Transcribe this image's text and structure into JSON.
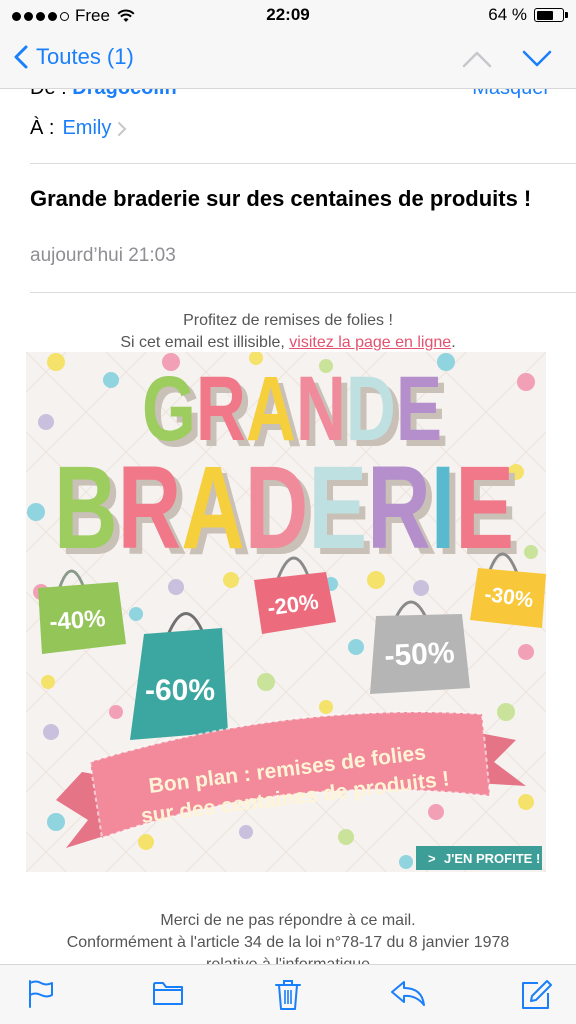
{
  "status_bar": {
    "carrier": "Free",
    "time": "22:09",
    "battery": "64 %",
    "battery_level": 0.64
  },
  "nav": {
    "back_label": "Toutes (1)"
  },
  "header": {
    "from_prefix": "De :",
    "from_name": "Dragocolin",
    "hide_label": "Masquer",
    "to_prefix": "À :",
    "to_name": "Emily",
    "subject": "Grande braderie sur des centaines de produits !",
    "date": "aujourd’hui 21:03"
  },
  "body": {
    "intro": "Profitez de remises de folies !",
    "illegible_prefix": "Si cet email est illisible, ",
    "illegible_link": "visitez la page en ligne",
    "illegible_suffix": ".",
    "banner": {
      "title_line1": "GRANDE",
      "title_line2": "BRADERIE",
      "discounts": [
        "-40%",
        "-20%",
        "-30%",
        "-60%",
        "-50%"
      ],
      "ribbon_line1": "Bon plan : remises de folies",
      "ribbon_line2": "sur des centaines de produits !",
      "cta": "J'EN PROFITE !",
      "cta_arrow": ">"
    },
    "footer_line1": "Merci de ne pas répondre à ce mail.",
    "footer_line2": "Conformément à l'article 34 de la loi n°78-17 du 8 janvier 1978",
    "footer_line3": "relative à l'informatique"
  },
  "toolbar": {
    "icons": [
      "flag-icon",
      "folder-icon",
      "trash-icon",
      "reply-icon",
      "compose-icon"
    ]
  },
  "colors": {
    "ios_blue": "#1a7ffb",
    "link_pink": "#e3526f"
  }
}
